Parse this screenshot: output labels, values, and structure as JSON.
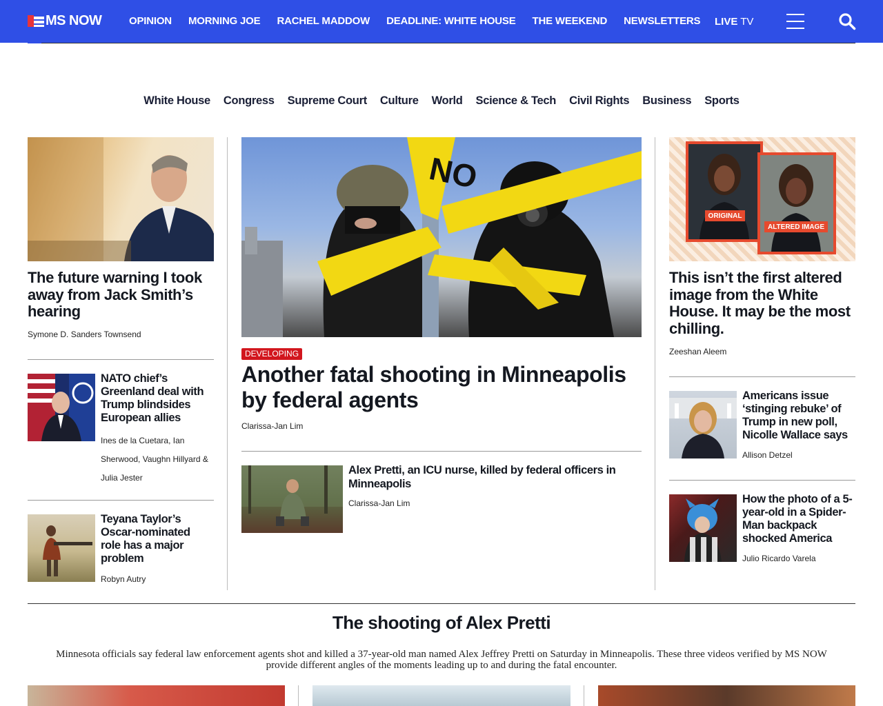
{
  "header": {
    "logo_text": "MS NOW",
    "nav": [
      "OPINION",
      "MORNING JOE",
      "RACHEL MADDOW",
      "DEADLINE: WHITE HOUSE",
      "THE WEEKEND",
      "NEWSLETTERS"
    ],
    "live_label_bold": "LIVE",
    "live_label": " TV",
    "brand_color": "#2f4fe6"
  },
  "subnav": [
    "White House",
    "Congress",
    "Supreme Court",
    "Culture",
    "World",
    "Science & Tech",
    "Civil Rights",
    "Business",
    "Sports"
  ],
  "left": {
    "lead": {
      "headline": "The future warning I took away from Jack Smith’s hearing",
      "byline": "Symone D. Sanders Townsend"
    },
    "items": [
      {
        "headline": "NATO chief’s Greenland deal with Trump blindsides European allies",
        "byline": "Ines de la Cuetara, Ian Sherwood, Vaughn Hillyard & Julia Jester"
      },
      {
        "headline": "Teyana Taylor’s Oscar-nominated role has a major problem",
        "byline": "Robyn Autry"
      }
    ]
  },
  "center": {
    "badge": "DEVELOPING",
    "headline": "Another fatal shooting in Minneapolis by federal agents",
    "byline": "Clarissa-Jan Lim",
    "image_caption_text": "NO",
    "related": {
      "headline": "Alex Pretti, an ICU nurse, killed by federal officers in Minneapolis",
      "byline": "Clarissa-Jan Lim"
    }
  },
  "right": {
    "lead": {
      "headline": "This isn’t the first altered image from the White House. It may be the most chilling.",
      "byline": "Zeeshan Aleem",
      "label_original": "ORIGINAL",
      "label_altered": "ALTERED IMAGE"
    },
    "items": [
      {
        "headline": "Americans issue ‘stinging rebuke’ of Trump in new poll, Nicolle Wallace says",
        "byline": "Allison Detzel"
      },
      {
        "headline": "How the photo of a 5-year-old in a Spider-Man backpack shocked America",
        "byline": "Julio Ricardo Varela"
      }
    ]
  },
  "section": {
    "title": "The shooting of Alex Pretti",
    "description": "Minnesota officials say federal law enforcement agents shot and killed a 37-year-old man named Alex Jeffrey Pretti on Saturday in Minneapolis. These three videos verified by MS NOW provide different angles of the moments leading up to and during the fatal encounter."
  }
}
